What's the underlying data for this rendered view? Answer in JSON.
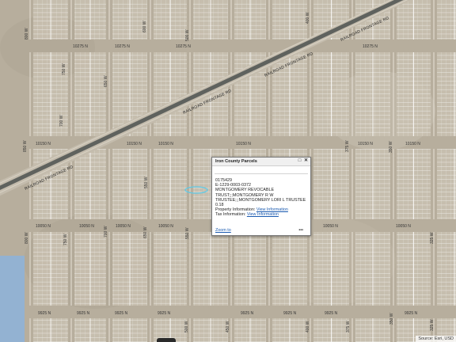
{
  "map": {
    "street_labels": {
      "row_10275": "10275 N",
      "row_10150": "10150 N",
      "row_10050": "10050 N",
      "row_9925": "9925 N",
      "col_850": "850 W",
      "col_800": "800 W",
      "col_750": "750 W",
      "col_700": "700 W",
      "col_650": "650 W",
      "col_600": "600 W",
      "col_550": "550 W",
      "col_500": "500 W",
      "col_450": "450 W",
      "col_400": "400 W",
      "col_375": "375 W",
      "col_350": "350 W",
      "col_325": "325 W"
    },
    "railroad_label": "RAILROAD FRONTAGE RD",
    "colors": {
      "terrain": "#b9b09f",
      "parcel_lines": "#ffffff",
      "railroad": "#5f625e",
      "water_area": "#8fb2d8",
      "highlight": "#5fc9e6"
    }
  },
  "popup": {
    "title": "Iron County Parcels",
    "parcel_id": "0175429",
    "account": "E-1229-0003-0372",
    "owner_line1": "MONTGOMERY REVOCABLE",
    "owner_line2": "TRUST;;;MONTGOMERY R W",
    "owner_line3": "TRUSTEE;;;MONTGOMERY LORI L TRUSTEE",
    "acreage": "0.18",
    "property_info_label": "Property Information:",
    "property_info_link": "View Information",
    "tax_info_label": "Tax Information:",
    "tax_info_link": "View Information",
    "zoom_to": "Zoom to",
    "more": "•••",
    "maximize_icon": "maximize-icon",
    "close_icon": "close-icon"
  },
  "attribution": "Source: Esri, USD"
}
